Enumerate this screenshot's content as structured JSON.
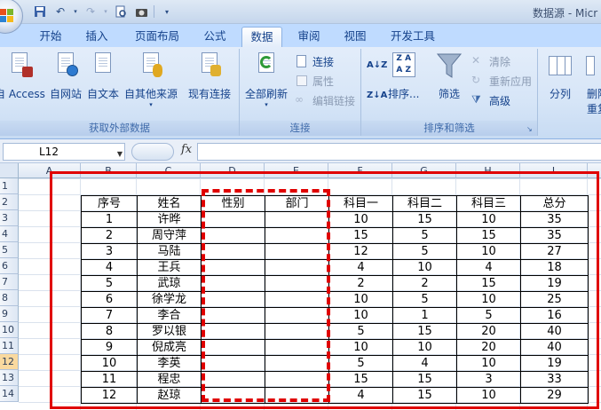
{
  "window": {
    "title": "数据源 - Micr"
  },
  "quick_access": {
    "icons": [
      "save-icon",
      "undo-icon",
      "redo-icon",
      "print-preview-icon",
      "camera-icon",
      "customize-icon"
    ]
  },
  "tabs": [
    {
      "label": "开始",
      "active": false
    },
    {
      "label": "插入",
      "active": false
    },
    {
      "label": "页面布局",
      "active": false
    },
    {
      "label": "公式",
      "active": false
    },
    {
      "label": "数据",
      "active": true
    },
    {
      "label": "审阅",
      "active": false
    },
    {
      "label": "视图",
      "active": false
    },
    {
      "label": "开发工具",
      "active": false
    }
  ],
  "ribbon": {
    "external": {
      "label": "获取外部数据",
      "from_access": "自 Access",
      "from_web": "自网站",
      "from_text": "自文本",
      "from_other": "自其他来源",
      "existing": "现有连接"
    },
    "connections": {
      "label": "连接",
      "refresh_all": "全部刷新",
      "connections": "连接",
      "properties": "属性",
      "edit_links": "编辑链接"
    },
    "sort_filter": {
      "label": "排序和筛选",
      "sort": "排序...",
      "filter": "筛选",
      "clear": "清除",
      "reapply": "重新应用",
      "advanced": "高级"
    },
    "tools": {
      "split": "分列",
      "remove_line1": "删除",
      "remove_line2": "重复"
    }
  },
  "formula_bar": {
    "name_box": "L12",
    "fx": "fx",
    "value": ""
  },
  "sheet": {
    "columns": [
      "A",
      "B",
      "C",
      "D",
      "E",
      "F",
      "G",
      "H",
      "I"
    ],
    "rows": [
      "1",
      "2",
      "3",
      "4",
      "5",
      "6",
      "7",
      "8",
      "9",
      "10",
      "11",
      "12",
      "13",
      "14"
    ],
    "selected_row": "12",
    "headers": [
      "序号",
      "姓名",
      "性别",
      "部门",
      "科目一",
      "科目二",
      "科目三",
      "总分"
    ],
    "records": [
      [
        "1",
        "许晔",
        "",
        "",
        "10",
        "15",
        "10",
        "35"
      ],
      [
        "2",
        "周守萍",
        "",
        "",
        "15",
        "5",
        "15",
        "35"
      ],
      [
        "3",
        "马陆",
        "",
        "",
        "12",
        "5",
        "10",
        "27"
      ],
      [
        "4",
        "王兵",
        "",
        "",
        "4",
        "10",
        "4",
        "18"
      ],
      [
        "5",
        "武琼",
        "",
        "",
        "2",
        "2",
        "15",
        "19"
      ],
      [
        "6",
        "徐学龙",
        "",
        "",
        "10",
        "5",
        "10",
        "25"
      ],
      [
        "7",
        "李合",
        "",
        "",
        "10",
        "1",
        "5",
        "16"
      ],
      [
        "8",
        "罗以银",
        "",
        "",
        "5",
        "15",
        "20",
        "40"
      ],
      [
        "9",
        "倪成亮",
        "",
        "",
        "10",
        "10",
        "20",
        "40"
      ],
      [
        "10",
        "李英",
        "",
        "",
        "5",
        "4",
        "10",
        "19"
      ],
      [
        "11",
        "程忠",
        "",
        "",
        "15",
        "15",
        "3",
        "33"
      ],
      [
        "12",
        "赵琼",
        "",
        "",
        "4",
        "15",
        "10",
        "29"
      ]
    ]
  },
  "annotation_color": "#e00000"
}
